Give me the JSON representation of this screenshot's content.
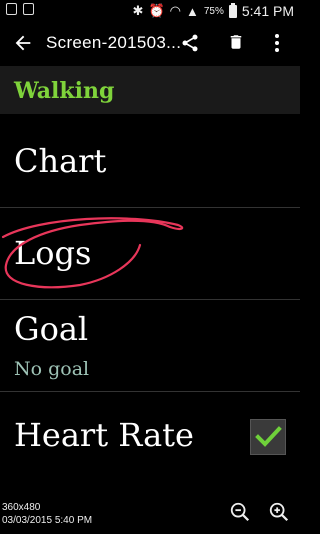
{
  "status_bar": {
    "battery": "75%",
    "time": "5:41 PM"
  },
  "toolbar": {
    "title": "Screen-201503..."
  },
  "section": {
    "title": "Walking"
  },
  "rows": [
    {
      "label": "Chart"
    },
    {
      "label": "Logs"
    },
    {
      "label": "Goal",
      "sub": "No goal"
    },
    {
      "label": "Heart Rate",
      "checked": true
    }
  ],
  "info": {
    "resolution": "360x480",
    "datetime": "03/03/2015 5:40 PM"
  },
  "colors": {
    "accent": "#7fd33b",
    "subtext": "#9ec3b6",
    "annotation": "#e8365a",
    "check": "#6fd13a"
  },
  "icons": [
    "back-arrow-icon",
    "share-icon",
    "delete-icon",
    "more-vert-icon",
    "check-icon",
    "zoom-out-icon",
    "zoom-in-icon"
  ]
}
